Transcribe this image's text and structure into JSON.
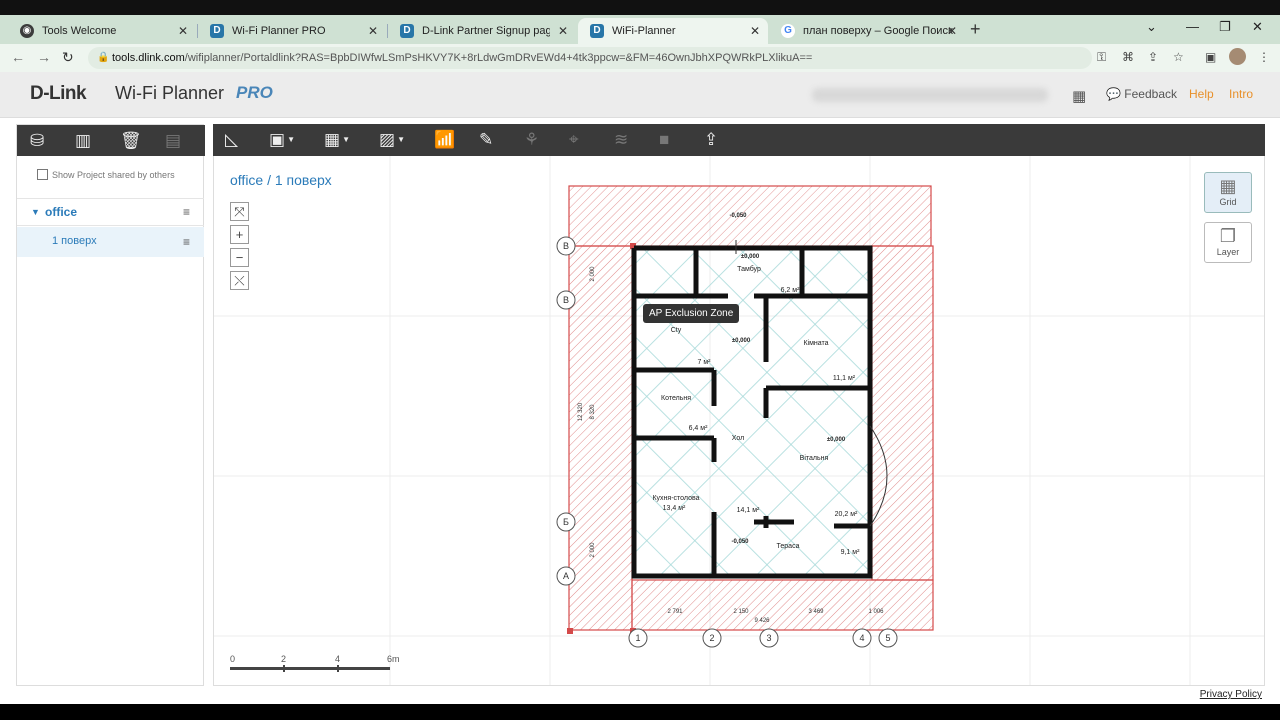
{
  "browser": {
    "tabs": [
      {
        "title": "Tools Welcome",
        "favicon": "globe"
      },
      {
        "title": "Wi-Fi Planner PRO",
        "favicon": "D"
      },
      {
        "title": "D-Link Partner Signup page for F",
        "favicon": "D"
      },
      {
        "title": "WiFi-Planner",
        "favicon": "D"
      },
      {
        "title": "план поверху – Google Поиск",
        "favicon": "G"
      }
    ],
    "new_tab": "+",
    "url_host": "tools.dlink.com",
    "url_path": "/wifiplanner/Portaldlink?RAS=BpbDIWfwLSmPsHKVY7K+8rLdwGmDRvEWd4+4tk3ppcw=&FM=46OwnJbhXPQWRkPLXlikuA=="
  },
  "header": {
    "logo": "D-Link",
    "product": "Wi-Fi Planner",
    "pro": "PRO",
    "feedback": "Feedback",
    "help": "Help",
    "intro": "Intro"
  },
  "sidebar": {
    "shared_label": "Show Project shared by others",
    "project": "office",
    "floor": "1 поверх"
  },
  "canvas": {
    "breadcrumb": "office / 1 поверх",
    "tooltip": "AP Exclusion Zone",
    "grid_label": "Grid",
    "layer_label": "Layer",
    "scale_ticks": [
      "0",
      "2",
      "4",
      "6m"
    ]
  },
  "plan": {
    "rooms": [
      {
        "name": "Тамбур",
        "area": "6,2 м²"
      },
      {
        "name": "Сtу",
        "area": "7 м²"
      },
      {
        "name": "Кімната",
        "area": "11,1 м²"
      },
      {
        "name": "Котельня",
        "area": "6,4 м²"
      },
      {
        "name": "Хол",
        "area": "14,1 м²"
      },
      {
        "name": "Вітальня",
        "area": "20,2 м²"
      },
      {
        "name": "Кухня-столова",
        "area": "13,4 м²"
      },
      {
        "name": "Тераса",
        "area": "9,1 м²"
      }
    ],
    "levels": [
      "-0,050",
      "±0,000",
      "±0,000",
      "±0,000",
      "-0,050"
    ],
    "axes_rows": [
      "В",
      "В",
      "Б",
      "А"
    ],
    "axes_cols": [
      "1",
      "2",
      "3",
      "4",
      "5"
    ],
    "dims_bottom": [
      "2 791",
      "2 150",
      "3 469",
      "1 006",
      "9 426"
    ],
    "dims_left": [
      "2 000",
      "12 320",
      "8 320",
      "2 000"
    ]
  },
  "footer": {
    "privacy": "Privacy Policy"
  },
  "colors": {
    "link": "#2b7bb9",
    "help": "#e8902a",
    "toolbar": "#3a3a3a",
    "exclusion": "#d44a4a"
  }
}
